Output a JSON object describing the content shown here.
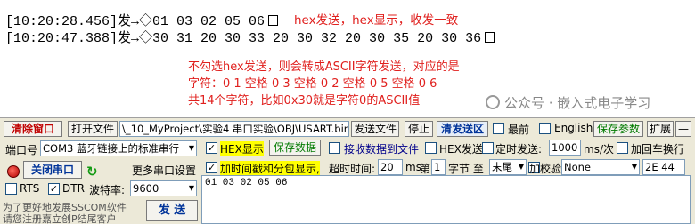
{
  "receive": {
    "line1": "[10:20:28.456]发→◇01 03 02 05 06",
    "line2": "[10:20:47.388]发→◇30 31 20 30 33 20 30 32 20 30 35 20 30 36"
  },
  "annotations": {
    "top": "hex发送，hex显示，收发一致",
    "line1": "不勾选hex发送，则会转成ASCII字符发送，对应的是",
    "line2": "字符：0 1 空格 0 3 空格 0 2 空格 0 5 空格 0 6",
    "line3": "共14个字符，比如0x30就是字符0的ASCII值"
  },
  "toolbar": {
    "clear_window": "清除窗口",
    "open_file": "打开文件",
    "file_path": "\\_10_MyProject\\实验4 串口实验\\OBJ\\USART.bin",
    "send_file": "发送文件",
    "stop": "停止",
    "clear_send": "清发送区",
    "topmost": "最前",
    "english": "English",
    "save_params": "保存参数",
    "expand": "扩展",
    "collapse": "—"
  },
  "port": {
    "port_label": "端口号",
    "port_value": "COM3 蓝牙链接上的标准串行",
    "close_port": "关闭串口",
    "more_settings": "更多串口设置",
    "rts": "RTS",
    "dtr": "DTR",
    "baud_label": "波特率:",
    "baud_value": "9600",
    "promo_line1": "为了更好地发展SSCOM软件",
    "promo_line2": "请您注册嘉立创P结尾客户",
    "send_button": "发 送"
  },
  "options": {
    "hex_display": "HEX显示",
    "save_data": "保存数据",
    "recv_to_file": "接收数据到文件",
    "hex_send": "HEX发送",
    "timed_send": "定时发送:",
    "interval_value": "1000",
    "interval_unit": "ms/次",
    "add_crlf": "加回车换行",
    "add_timestamp": "加时间戳和分包显示,",
    "timeout_label": "超时时间:",
    "timeout_value": "20",
    "timeout_unit": "ms",
    "nth_label": "第",
    "nth_value": "1",
    "byte_label": "字节 至",
    "end_value": "末尾",
    "checksum_label": "加校验",
    "checksum_value": "None",
    "checksum_result": "2E 44"
  },
  "send_area_text": "01 03 02 05 06",
  "watermark": "公众号 · 嵌入式电子学习",
  "colors": {
    "annotation": "#e0201e",
    "panel_bg": "#ece9d8",
    "highlight": "#ffff00"
  }
}
